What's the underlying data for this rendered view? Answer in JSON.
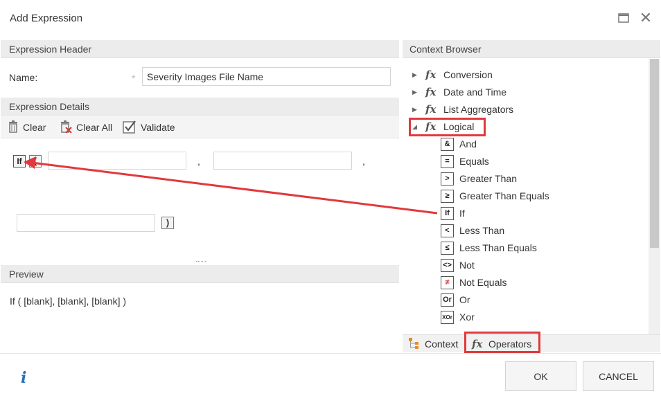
{
  "window": {
    "title": "Add Expression",
    "maximize_icon": "maximize-icon",
    "close_glyph": "✕"
  },
  "expression_header": {
    "section_title": "Expression Header",
    "name_label": "Name:",
    "required_marker": "*",
    "name_value": "Severity Images File Name"
  },
  "expression_details": {
    "section_title": "Expression Details",
    "toolbar": {
      "clear_label": "Clear",
      "clear_all_label": "Clear All",
      "validate_label": "Validate"
    },
    "builder": {
      "function_label": "If",
      "open_paren": "(",
      "close_paren": ")",
      "separator": ","
    }
  },
  "preview": {
    "section_title": "Preview",
    "text": "If ( [blank], [blank], [blank] )"
  },
  "context_browser": {
    "section_title": "Context Browser",
    "categories": [
      {
        "label": "Conversion",
        "expanded": false
      },
      {
        "label": "Date and Time",
        "expanded": false
      },
      {
        "label": "List Aggregators",
        "expanded": false
      },
      {
        "label": "Logical",
        "expanded": true
      }
    ],
    "logical_items": [
      {
        "label": "And",
        "icon": "&"
      },
      {
        "label": "Equals",
        "icon": "="
      },
      {
        "label": "Greater Than",
        "icon": ">"
      },
      {
        "label": "Greater Than Equals",
        "icon": "≥"
      },
      {
        "label": "If",
        "icon": "If"
      },
      {
        "label": "Less Than",
        "icon": "<"
      },
      {
        "label": "Less Than Equals",
        "icon": "≤"
      },
      {
        "label": "Not",
        "icon": "<>"
      },
      {
        "label": "Not Equals",
        "icon": "≠"
      },
      {
        "label": "Or",
        "icon": "Or"
      },
      {
        "label": "Xor",
        "icon": "XOr"
      }
    ],
    "tabs": {
      "context_label": "Context",
      "operators_label": "Operators"
    }
  },
  "footer": {
    "info_glyph": "i",
    "ok_label": "OK",
    "cancel_label": "CANCEL"
  },
  "colors": {
    "highlight": "#e0393e",
    "header_bg": "#ececec",
    "info_blue": "#2a6ebb"
  }
}
